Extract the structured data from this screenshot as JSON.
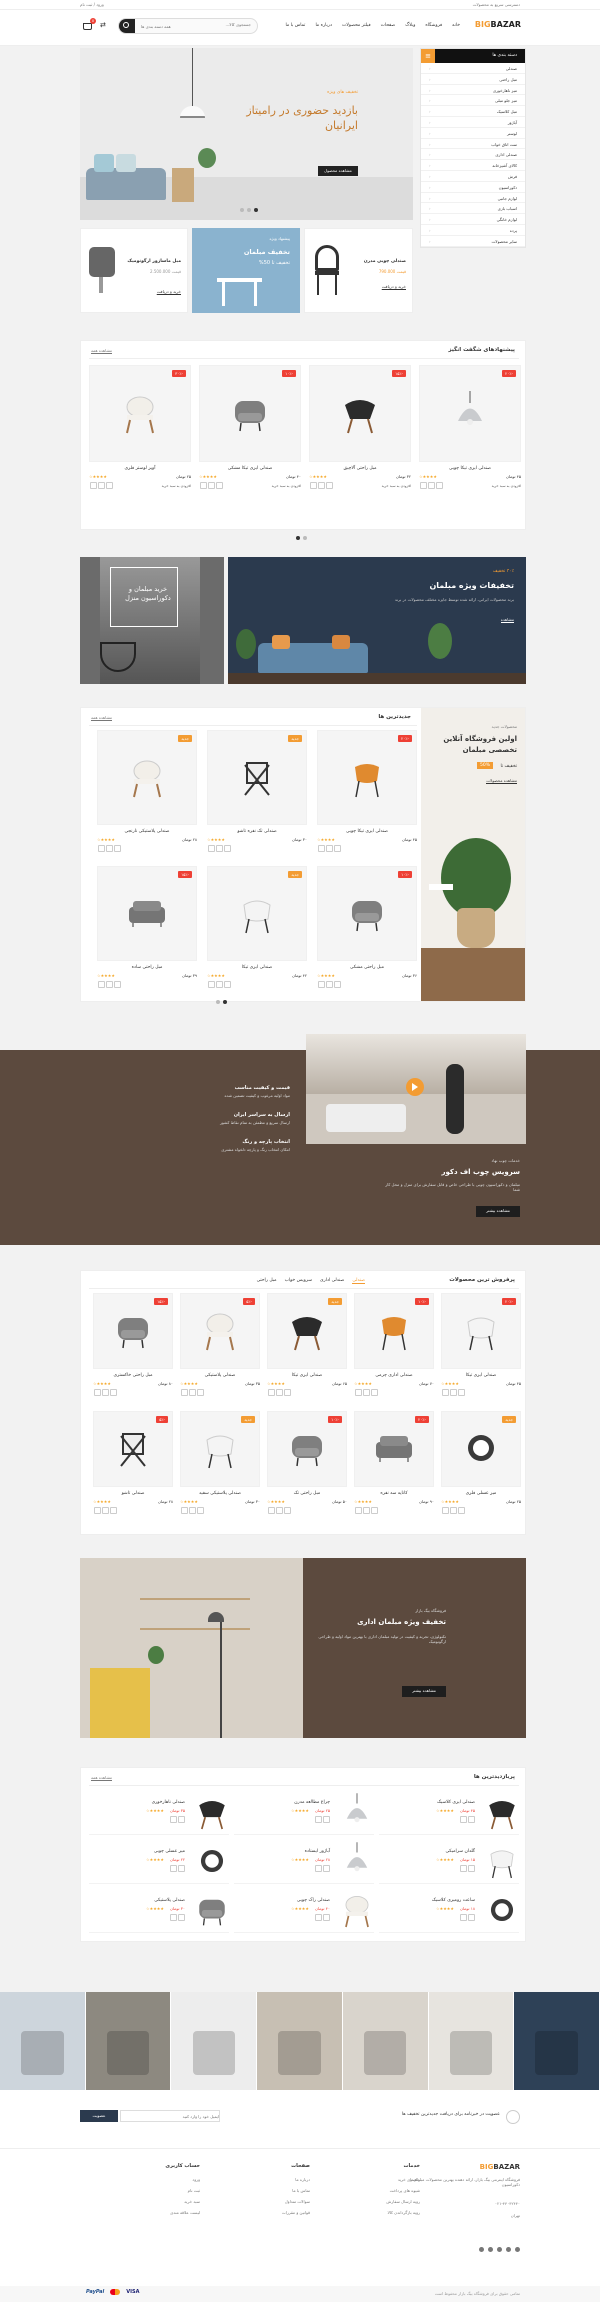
{
  "topbar": {
    "right": "دسترسی سریع به محصولات",
    "left": "ورود / ثبت نام",
    "links": [
      "تماس با ما",
      "درباره ما",
      "وبلاگ",
      "فروشگاه"
    ]
  },
  "header": {
    "logo_a": "BIG",
    "logo_b": "BAZAR",
    "search_placeholder": "جستجوی کالا...",
    "search_cat": "همه دسته بندی ها",
    "cart_count": "0",
    "nav": [
      "خانه",
      "فروشگاه",
      "وبلاگ",
      "صفحات",
      "فیلتر محصولات",
      "درباره ما",
      "تماس با ما"
    ]
  },
  "sidebar": {
    "title": "دسته بندی ها",
    "items": [
      "صندلی",
      "مبل راحتی",
      "میز ناهارخوری",
      "میز جلو مبلی",
      "مبل کلاسیک",
      "آباژور",
      "لوستر",
      "ست اتاق خواب",
      "صندلی اداری",
      "کالای آشپزخانه",
      "فرش",
      "دکوراسیون",
      "لوازم جانبی",
      "اسباب بازی",
      "لوازم خانگی",
      "پرده",
      "سایر محصولات"
    ]
  },
  "hero": {
    "kicker": "تخفیف های ویژه",
    "title": "بازدید حضوری در رامیتاز ایرانیان",
    "button": "مشاهده محصول",
    "dots": [
      "1",
      "2",
      "3"
    ]
  },
  "promo": [
    {
      "title": "تخفیف مبلمان",
      "sub": "تخفیف تا 50%",
      "kicker": "پیشنهاد ویژه"
    },
    {
      "title": "صندلی چوبی مدرن",
      "sub": "قیمت 790.000",
      "link": "خرید و دریافت"
    },
    {
      "title": "مبل ماساژور ارگونومیک",
      "sub": "قیمت 2.500.000",
      "link": "خرید و دریافت"
    }
  ],
  "featured": {
    "title": "پیشنهادهای شگفت انگیز",
    "more": "مشاهده همه",
    "products": [
      {
        "name": "صندلی ایزی تیکا چوبی",
        "price": "۴۵ تومان",
        "tag": "-۲۰٪",
        "btn": "افزودن به سبد خرید"
      },
      {
        "name": "مبل راحتی آلاچیق",
        "price": "۳۲ تومان",
        "tag": "-۱۵٪",
        "btn": "افزودن به سبد خرید"
      },
      {
        "name": "صندلی ایزی تیکا مشکی",
        "price": "۴۰ تومان",
        "tag": "-۱۰٪",
        "btn": "افزودن به سبد خرید"
      },
      {
        "name": "آویز لوستر فلزی",
        "price": "۲۵ تومان",
        "tag": "-۳۰٪",
        "btn": "افزودن به سبد خرید"
      }
    ]
  },
  "banners": {
    "right_kicker": "۳۰٪ تخفیف",
    "right_title": "تخفیفات ویژه مبلمان",
    "right_text": "برند محصولات ایرانی، ارائه شده توسط جایزه مختلف محصولات در برند",
    "right_link": "مشاهده",
    "left_title": "خرید مبلمان و دکوراسیون منزل"
  },
  "newest": {
    "title": "جدیدترین ها",
    "more": "مشاهده همه",
    "side_kicker": "محصولات جدید",
    "side_title": "اولین فروشگاه آنلاین تخصصی مبلمان",
    "side_sub": "تخفیف تا",
    "side_pct": "50%",
    "side_link": "مشاهده محصولات",
    "products": [
      {
        "name": "صندلی ایزی تیکا چوبی",
        "price": "۴۵ تومان",
        "tag": "-۲۰٪"
      },
      {
        "name": "صندلی تک نفره تاشو",
        "price": "۳۰ تومان",
        "tag": "جدید"
      },
      {
        "name": "صندلی پلاستیکی نارنجی",
        "price": "۲۸ تومان",
        "tag": "جدید"
      },
      {
        "name": "مبل راحتی مشکی",
        "price": "۳۶ تومان",
        "tag": "-۱۰٪"
      },
      {
        "name": "صندلی ایزی تیکا",
        "price": "۴۲ تومان",
        "tag": "جدید"
      },
      {
        "name": "مبل راحتی ساده",
        "price": "۳۹ تومان",
        "tag": "-۱۵٪"
      }
    ]
  },
  "service": {
    "items": [
      {
        "title": "قیمت و کیفیت مناسب",
        "text": "مواد اولیه مرغوب و کیفیت تضمین شده"
      },
      {
        "title": "ارسال به سراسر ایران",
        "text": "ارسال سریع و مطمئن به تمام نقاط کشور"
      },
      {
        "title": "انتخاب پارچه و رنگ",
        "text": "امکان انتخاب رنگ و پارچه دلخواه مشتری"
      }
    ],
    "kicker": "خدمات چوب نهاد",
    "title": "سرویس چوب اف دکور",
    "text": "مبلمان و دکوراسیون چوبی با طراحی خاص و قابل سفارش برای منزل و محل کار شما",
    "button": "مشاهده بیشتر"
  },
  "bestseller": {
    "title": "پرفروش ترین محصولات",
    "tabs": [
      "صندلی",
      "صندلی اداری",
      "سرویس خواب",
      "مبل راحتی"
    ],
    "products": [
      {
        "name": "صندلی ایزی تیکا",
        "price": "۴۵ تومان",
        "tag": "-۲۰٪"
      },
      {
        "name": "صندلی اداری چرمی",
        "price": "۷۰ تومان",
        "tag": "-۱۰٪"
      },
      {
        "name": "صندلی ایزی تیکا",
        "price": "۶۵ تومان",
        "tag": "جدید"
      },
      {
        "name": "صندلی پلاستیکی",
        "price": "۳۵ تومان",
        "tag": "-۵٪"
      },
      {
        "name": "مبل راحتی خاکستری",
        "price": "۸۰ تومان",
        "tag": "-۱۵٪"
      },
      {
        "name": "میز عسلی فلزی",
        "price": "۲۵ تومان",
        "tag": "جدید"
      },
      {
        "name": "کاناپه سه نفره",
        "price": "۹۰ تومان",
        "tag": "-۲۰٪"
      },
      {
        "name": "مبل راحتی تک",
        "price": "۵۰ تومان",
        "tag": "-۱۰٪"
      },
      {
        "name": "صندلی پلاستیکی سفید",
        "price": "۳۰ تومان",
        "tag": "جدید"
      },
      {
        "name": "صندلی تاشو",
        "price": "۲۸ تومان",
        "tag": "-۵٪"
      }
    ]
  },
  "office": {
    "kicker": "فروشگاه بیگ بازار",
    "title": "تخفیف ویژه مبلمان اداری",
    "text": "تکنولوژی، تجربه و کیفیت در تولید مبلمان اداری با بهترین مواد اولیه و طراحی ارگونومیک",
    "button": "مشاهده بیشتر"
  },
  "popular": {
    "title": "پربازدیدترین ها",
    "more": "مشاهده همه",
    "items": [
      {
        "name": "صندلی ایزی کلاسیک",
        "price": "۴۵ تومان"
      },
      {
        "name": "چراغ مطالعه مدرن",
        "price": "۲۵ تومان"
      },
      {
        "name": "صندلی ناهارخوری",
        "price": "۳۵ تومان"
      },
      {
        "name": "گلدان سرامیکی",
        "price": "۱۵ تومان"
      },
      {
        "name": "آباژور ایستاده",
        "price": "۲۸ تومان"
      },
      {
        "name": "میز عسلی چوبی",
        "price": "۲۲ تومان"
      },
      {
        "name": "ساعت رومیزی کلاسیک",
        "price": "۱۸ تومان"
      },
      {
        "name": "صندلی راک چوبی",
        "price": "۴۰ تومان"
      },
      {
        "name": "صندلی پلاستیکی",
        "price": "۳۰ تومان"
      }
    ]
  },
  "newsletter": {
    "text": "عضویت در خبرنامه برای دریافت جدیدترین تخفیف ها",
    "placeholder": "ایمیل خود را وارد کنید",
    "button": "عضویت"
  },
  "footer": {
    "logo_a": "BIG",
    "logo_b": "BAZAR",
    "about": "فروشگاه اینترنتی بیگ بازار، ارائه دهنده بهترین محصولات مبلمان و دکوراسیون",
    "phone": "۰۲۱-۴۴۰۴۲۴۴۰",
    "addr": "تهران",
    "cols": [
      {
        "title": "خدمات",
        "links": [
          "راهنمای خرید",
          "شیوه های پرداخت",
          "رویه ارسال سفارش",
          "رویه بازگرداندن کالا"
        ]
      },
      {
        "title": "صفحات",
        "links": [
          "درباره ما",
          "تماس با ما",
          "سوالات متداول",
          "قوانین و مقررات"
        ]
      },
      {
        "title": "حساب کاربری",
        "links": [
          "ورود",
          "ثبت نام",
          "سبد خرید",
          "لیست علاقه مندی"
        ]
      }
    ],
    "copyright": "تمامی حقوق برای فروشگاه بیگ بازار محفوظ است",
    "pay": [
      "PayPal",
      "VISA"
    ]
  }
}
